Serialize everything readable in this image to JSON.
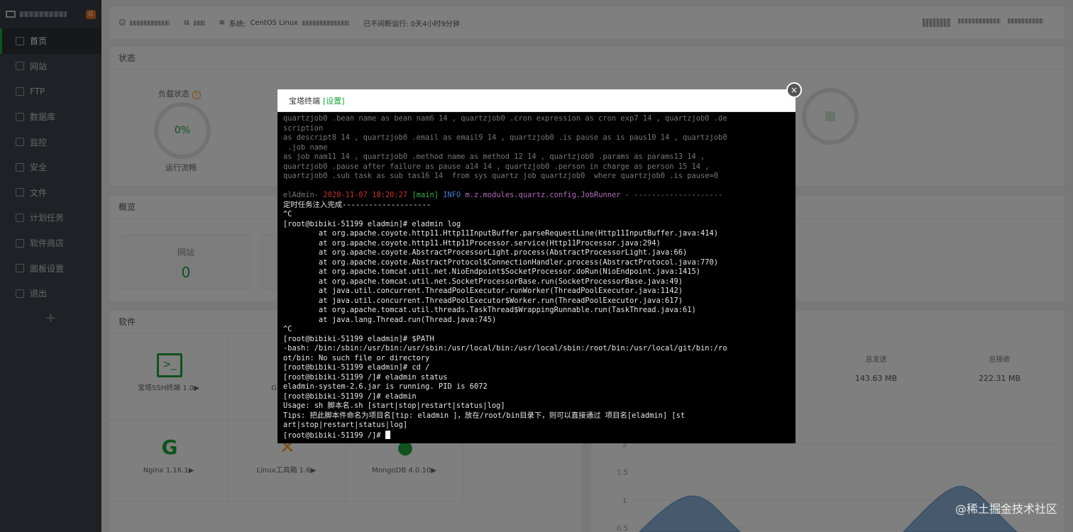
{
  "sidebar": {
    "badge": "0",
    "items": [
      {
        "label": "首页",
        "icon": "home-icon"
      },
      {
        "label": "网站",
        "icon": "globe-icon"
      },
      {
        "label": "FTP",
        "icon": "ftp-icon"
      },
      {
        "label": "数据库",
        "icon": "database-icon"
      },
      {
        "label": "监控",
        "icon": "monitor-icon"
      },
      {
        "label": "安全",
        "icon": "shield-icon"
      },
      {
        "label": "文件",
        "icon": "folder-icon"
      },
      {
        "label": "计划任务",
        "icon": "calendar-icon"
      },
      {
        "label": "软件商店",
        "icon": "apps-icon"
      },
      {
        "label": "面板设置",
        "icon": "gear-icon"
      },
      {
        "label": "退出",
        "icon": "logout-icon"
      }
    ],
    "add": "+"
  },
  "topbar": {
    "system_label": "系统:",
    "system_value": "CentOS Linux",
    "uptime": "已不间断运行: 0天4小时9分钟"
  },
  "status": {
    "title": "状态",
    "load_label": "负载状态",
    "load_value": "0%",
    "load_caption": "运行流畅"
  },
  "overview": {
    "title": "概览",
    "card_label": "网站",
    "card_value": "0"
  },
  "software": {
    "title": "软件",
    "items": [
      "宝塔SSH终端 1.0▶",
      "GitLab中",
      "Nginx 1.16.1▶",
      "Linux工具箱 1.6▶",
      "MongoDB 4.0.10▶"
    ]
  },
  "traffic": {
    "sent_label": "总发送",
    "sent_value": "143.63 MB",
    "recv_label": "总接收",
    "recv_value": "222.31 MB",
    "yticks": [
      "2",
      "1.5",
      "1",
      "0.5"
    ]
  },
  "modal": {
    "title": "宝塔终端",
    "settings": "[设置]",
    "close": "×",
    "lines": [
      {
        "c": "gray",
        "t": "quartzjob0 .bean name as bean nam6 14 , quartzjob0 .cron expression as cron exp7 14 , quartzjob0 .de"
      },
      {
        "c": "gray",
        "t": "scription"
      },
      {
        "c": "gray",
        "t": "as descript8 14 , quartzjob0 .email as email9 14 , quartzjob0 .is pause as is paus10 14 , quartzjob0"
      },
      {
        "c": "gray",
        "t": " .job name"
      },
      {
        "c": "gray",
        "t": "as job nam11 14 , quartzjob0 .method name as method 12 14 , quartzjob0 .params as params13 14 ,"
      },
      {
        "c": "gray",
        "t": "quartzjob0 .pause after failure as pause a14 14 , quartzjob0 .person in charge as person 15 14 ,"
      },
      {
        "c": "gray",
        "t": "quartzjob0 .sub task as sub tas16 14  from sys quartz job quartzjob0  where quartzjob0 .is pause=0"
      },
      {
        "c": "",
        "t": ""
      },
      {
        "c": "log",
        "t": ""
      },
      {
        "c": "",
        "t": "定时任务注入完成--------------------"
      },
      {
        "c": "",
        "t": "^C"
      },
      {
        "c": "",
        "t": "[root@bibiki-51199 eladmin]# eladmin log"
      },
      {
        "c": "",
        "t": "        at org.apache.coyote.http11.Http11InputBuffer.parseRequestLine(Http11InputBuffer.java:414)"
      },
      {
        "c": "",
        "t": "        at org.apache.coyote.http11.Http11Processor.service(Http11Processor.java:294)"
      },
      {
        "c": "",
        "t": "        at org.apache.coyote.AbstractProcessorLight.process(AbstractProcessorLight.java:66)"
      },
      {
        "c": "",
        "t": "        at org.apache.coyote.AbstractProtocol$ConnectionHandler.process(AbstractProtocol.java:770)"
      },
      {
        "c": "",
        "t": "        at org.apache.tomcat.util.net.NioEndpoint$SocketProcessor.doRun(NioEndpoint.java:1415)"
      },
      {
        "c": "",
        "t": "        at org.apache.tomcat.util.net.SocketProcessorBase.run(SocketProcessorBase.java:49)"
      },
      {
        "c": "",
        "t": "        at java.util.concurrent.ThreadPoolExecutor.runWorker(ThreadPoolExecutor.java:1142)"
      },
      {
        "c": "",
        "t": "        at java.util.concurrent.ThreadPoolExecutor$Worker.run(ThreadPoolExecutor.java:617)"
      },
      {
        "c": "",
        "t": "        at org.apache.tomcat.util.threads.TaskThread$WrappingRunnable.run(TaskThread.java:61)"
      },
      {
        "c": "",
        "t": "        at java.lang.Thread.run(Thread.java:745)"
      },
      {
        "c": "",
        "t": "^C"
      },
      {
        "c": "",
        "t": "[root@bibiki-51199 eladmin]# $PATH"
      },
      {
        "c": "",
        "t": "-bash: /bin:/sbin:/usr/bin:/usr/sbin:/usr/local/bin:/usr/local/sbin:/root/bin:/usr/local/git/bin:/ro"
      },
      {
        "c": "",
        "t": "ot/bin: No such file or directory"
      },
      {
        "c": "",
        "t": "[root@bibiki-51199 eladmin]# cd /"
      },
      {
        "c": "",
        "t": "[root@bibiki-51199 /]# eladmin status"
      },
      {
        "c": "",
        "t": "eladmin-system-2.6.jar is running. PID is 6072"
      },
      {
        "c": "",
        "t": "[root@bibiki-51199 /]# eladmin"
      },
      {
        "c": "",
        "t": "Usage: sh 脚本名.sh [start|stop|restart|status|log]"
      },
      {
        "c": "",
        "t": "Tips: 把此脚本件命名为项目名[tip: eladmin ]，放在/root/bin目录下，则可以直接通过 项目名[eladmin] [st"
      },
      {
        "c": "",
        "t": "art|stop|restart|status|log]"
      },
      {
        "c": "prompt",
        "t": "[root@bibiki-51199 /]# "
      }
    ],
    "log_line": {
      "app": "elAdmin- ",
      "time": "2020-11-07 18:20:27",
      "thread": "[main]",
      "level": "INFO",
      "cls": "m.z.modules.quartz.config.JobRunner",
      "rest": " - --------------------"
    }
  },
  "watermark": "@稀土掘金技术社区"
}
